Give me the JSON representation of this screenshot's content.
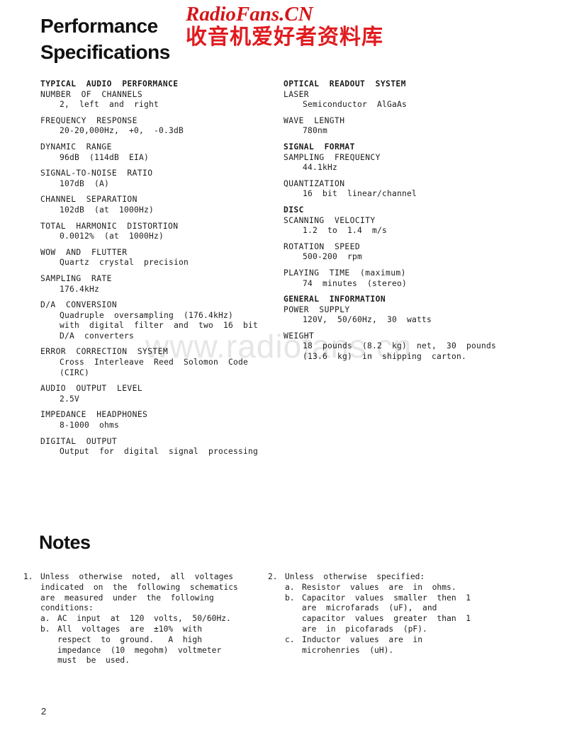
{
  "logo": {
    "english": "RadioFans.CN",
    "chinese": "收音机爱好者资料库",
    "color_en": "#d4161a",
    "color_cn": "#e01b20"
  },
  "watermark": {
    "text": "www.radiofans.cn",
    "color": "#e6e6e6"
  },
  "headings": {
    "performance": "Performance\nSpecifications",
    "notes": "Notes"
  },
  "specs": {
    "left_column": [
      {
        "group_title": "TYPICAL  AUDIO  PERFORMANCE",
        "entries": [
          {
            "head": "NUMBER  OF  CHANNELS",
            "values": [
              "2,  left  and  right"
            ]
          }
        ]
      },
      {
        "entries": [
          {
            "head": "FREQUENCY  RESPONSE",
            "values": [
              "20-20,000Hz,  +0,  -0.3dB"
            ]
          }
        ]
      },
      {
        "entries": [
          {
            "head": "DYNAMIC  RANGE",
            "values": [
              "96dB  (114dB  EIA)"
            ]
          }
        ]
      },
      {
        "entries": [
          {
            "head": "SIGNAL-TO-NOISE  RATIO",
            "values": [
              "107dB  (A)"
            ]
          }
        ]
      },
      {
        "entries": [
          {
            "head": "CHANNEL  SEPARATION",
            "values": [
              "102dB  (at  1000Hz)"
            ]
          }
        ]
      },
      {
        "entries": [
          {
            "head": "TOTAL  HARMONIC  DISTORTION",
            "values": [
              "0.0012%  (at  1000Hz)"
            ]
          }
        ]
      },
      {
        "entries": [
          {
            "head": "WOW  AND  FLUTTER",
            "values": [
              "Quartz  crystal  precision"
            ]
          }
        ]
      },
      {
        "entries": [
          {
            "head": "SAMPLING  RATE",
            "values": [
              "176.4kHz"
            ]
          }
        ]
      },
      {
        "entries": [
          {
            "head": "D/A  CONVERSION",
            "values": [
              "Quadruple  oversampling  (176.4kHz)",
              "with  digital  filter  and  two  16  bit",
              "D/A  converters"
            ]
          }
        ]
      },
      {
        "entries": [
          {
            "head": "ERROR  CORRECTION  SYSTEM",
            "values": [
              "Cross  Interleave  Reed  Solomon  Code",
              "(CIRC)"
            ]
          }
        ]
      },
      {
        "entries": [
          {
            "head": "AUDIO  OUTPUT  LEVEL",
            "values": [
              "2.5V"
            ]
          }
        ]
      },
      {
        "entries": [
          {
            "head": "IMPEDANCE  HEADPHONES",
            "values": [
              "8-1000  ohms"
            ]
          }
        ]
      },
      {
        "entries": [
          {
            "head": "DIGITAL  OUTPUT",
            "values": [
              "Output  for  digital  signal  processing"
            ]
          }
        ]
      }
    ],
    "right_column": [
      {
        "group_title": "OPTICAL  READOUT  SYSTEM",
        "entries": [
          {
            "head": "LASER",
            "values": [
              "Semiconductor  AlGaAs"
            ]
          }
        ]
      },
      {
        "entries": [
          {
            "head": "WAVE  LENGTH",
            "values": [
              "780nm"
            ]
          }
        ]
      },
      {
        "group_title": "SIGNAL  FORMAT",
        "entries": [
          {
            "head": "SAMPLING  FREQUENCY",
            "values": [
              "44.1kHz"
            ]
          }
        ]
      },
      {
        "entries": [
          {
            "head": "QUANTIZATION",
            "values": [
              "16  bit  linear/channel"
            ]
          }
        ]
      },
      {
        "group_title": "DISC",
        "entries": [
          {
            "head": "SCANNING  VELOCITY",
            "values": [
              "1.2  to  1.4  m/s"
            ]
          }
        ]
      },
      {
        "entries": [
          {
            "head": "ROTATION  SPEED",
            "values": [
              "500-200  rpm"
            ]
          }
        ]
      },
      {
        "entries": [
          {
            "head": "PLAYING  TIME  (maximum)",
            "values": [
              "74  minutes  (stereo)"
            ]
          }
        ]
      },
      {
        "group_title": "GENERAL  INFORMATION",
        "entries": [
          {
            "head": "POWER  SUPPLY",
            "values": [
              "120V,  50/60Hz,  30  watts"
            ]
          }
        ]
      },
      {
        "entries": [
          {
            "head": "WEIGHT",
            "values": [
              "18  pounds  (8.2  kg)  net,  30  pounds",
              "(13.6  kg)  in  shipping  carton."
            ]
          }
        ]
      }
    ]
  },
  "notes": {
    "left": [
      {
        "number": "1.",
        "lines": [
          "Unless  otherwise  noted,  all  voltages",
          "indicated  on  the  following  schematics",
          "are  measured  under  the  following",
          "conditions:"
        ],
        "sub": [
          {
            "letter": "a.",
            "lines": [
              "AC  input  at  120  volts,  50/60Hz."
            ]
          },
          {
            "letter": "b.",
            "lines": [
              "All  voltages  are  ±10%  with",
              "respect  to  ground.   A  high",
              "impedance  (10  megohm)  voltmeter",
              "must  be  used."
            ]
          }
        ]
      }
    ],
    "right": [
      {
        "number": "2.",
        "lines": [
          "Unless  otherwise  specified:"
        ],
        "sub": [
          {
            "letter": "a.",
            "lines": [
              "Resistor  values  are  in  ohms."
            ]
          },
          {
            "letter": "b.",
            "lines": [
              "Capacitor  values  smaller  then  1",
              "are  microfarads  (uF),  and",
              "capacitor  values  greater  than  1",
              "are  in  picofarads  (pF)."
            ]
          },
          {
            "letter": "c.",
            "lines": [
              "Inductor  values  are  in",
              "microhenries  (uH)."
            ]
          }
        ]
      }
    ]
  },
  "footer": {
    "page_number": "2"
  }
}
